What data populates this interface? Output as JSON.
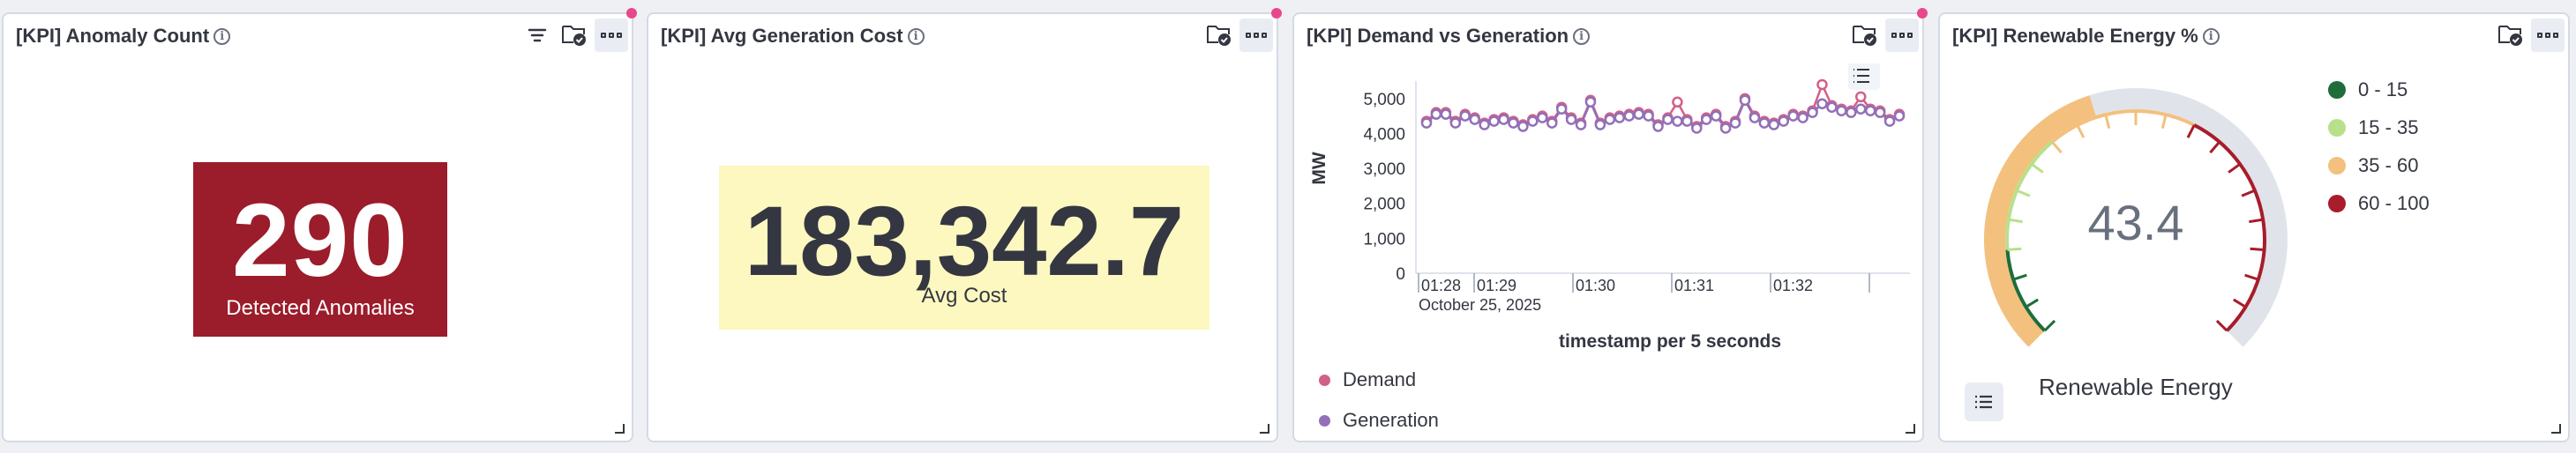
{
  "panels": [
    {
      "title": "[KPI] Anomaly Count",
      "metric": {
        "value": "290",
        "label": "Detected Anomalies"
      }
    },
    {
      "title": "[KPI] Avg Generation Cost",
      "metric": {
        "value": "183,342.7",
        "label": "Avg Cost"
      }
    },
    {
      "title": "[KPI] Demand vs Generation",
      "chart": {
        "ylabel": "MW",
        "xlabel": "timestamp per 5 seconds",
        "date_label": "October 25, 2025",
        "legend": [
          "Demand",
          "Generation"
        ]
      }
    },
    {
      "title": "[KPI] Renewable Energy %",
      "gauge": {
        "value_text": "43.4",
        "label": "Renewable Energy",
        "legend": [
          {
            "label": "0 - 15",
            "color": "#1e6d3b"
          },
          {
            "label": "15 - 35",
            "color": "#b8e08a"
          },
          {
            "label": "35 - 60",
            "color": "#f3c07e"
          },
          {
            "label": "60 - 100",
            "color": "#a81c2b"
          }
        ]
      }
    }
  ],
  "colors": {
    "demand": "#d36086",
    "generation": "#9170b8",
    "anomaly_bg": "#9b1c2a",
    "cost_bg": "#fcf8c0"
  },
  "chart_data": {
    "type": "line",
    "ylabel": "MW",
    "xlabel": "timestamp per 5 seconds",
    "ylim": [
      0,
      5500
    ],
    "yticks": [
      0,
      1000,
      2000,
      3000,
      4000,
      5000
    ],
    "x_tick_labels": [
      "01:28",
      "01:29",
      "01:30",
      "01:31",
      "01:32"
    ],
    "x_count": 50,
    "series": [
      {
        "name": "Demand",
        "color": "#d36086",
        "values": [
          4350,
          4600,
          4600,
          4350,
          4550,
          4450,
          4300,
          4400,
          4450,
          4350,
          4250,
          4400,
          4500,
          4350,
          4750,
          4450,
          4300,
          4950,
          4300,
          4450,
          4500,
          4550,
          4600,
          4550,
          4250,
          4450,
          4900,
          4400,
          4200,
          4450,
          4550,
          4200,
          4350,
          5000,
          4500,
          4350,
          4300,
          4400,
          4550,
          4500,
          4650,
          5400,
          4800,
          4700,
          4650,
          5050,
          4700,
          4650,
          4400,
          4550
        ]
      },
      {
        "name": "Generation",
        "color": "#9170b8",
        "values": [
          4300,
          4550,
          4550,
          4300,
          4500,
          4400,
          4250,
          4350,
          4400,
          4300,
          4200,
          4350,
          4450,
          4300,
          4700,
          4400,
          4250,
          4900,
          4250,
          4400,
          4450,
          4500,
          4550,
          4500,
          4200,
          4400,
          4350,
          4350,
          4150,
          4400,
          4500,
          4150,
          4300,
          4950,
          4450,
          4300,
          4250,
          4350,
          4500,
          4450,
          4600,
          4850,
          4750,
          4650,
          4600,
          4700,
          4650,
          4600,
          4350,
          4500
        ]
      }
    ]
  },
  "gauge_data": {
    "value": 43.4,
    "min": 0,
    "max": 100
  }
}
